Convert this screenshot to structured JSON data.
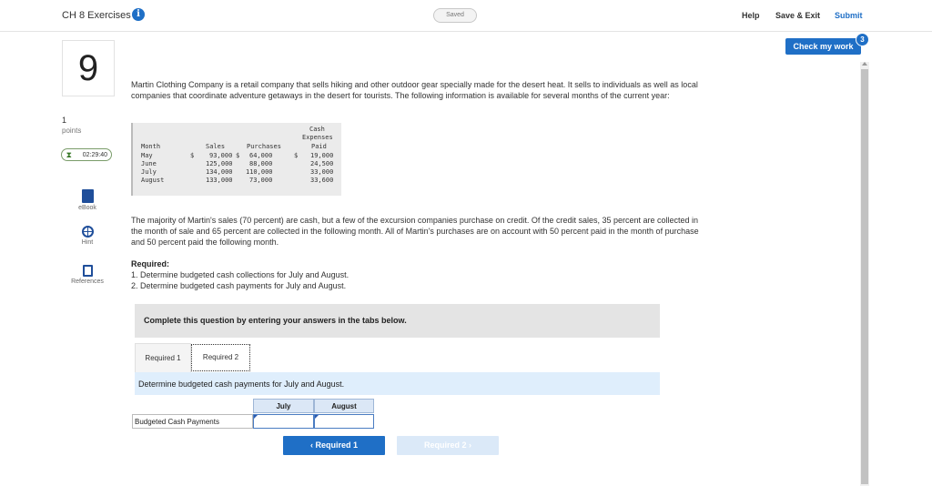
{
  "header": {
    "title": "CH 8 Exercises",
    "info_glyph": "i",
    "saved_label": "Saved",
    "help_label": "Help",
    "save_exit_label": "Save & Exit",
    "submit_label": "Submit",
    "check_label": "Check my work",
    "check_badge": "3",
    "accent_color": "#1f6fc6"
  },
  "sidebar": {
    "question_number": "9",
    "points_value": "1",
    "points_label": "points",
    "timer": "02:29:40",
    "tools": [
      {
        "label": "eBook",
        "icon": "ebook-icon"
      },
      {
        "label": "Hint",
        "icon": "hint-icon"
      },
      {
        "label": "References",
        "icon": "references-icon"
      }
    ]
  },
  "question": {
    "intro": "Martin Clothing Company is a retail company that sells hiking and other outdoor gear specially made for the desert heat. It sells to individuals as well as local companies that coordinate adventure getaways in the desert for tourists. The following information is available for several months of the current year:",
    "table": {
      "header_row1": "Cash",
      "header_row2": "Expenses",
      "col_month": "Month",
      "col_sales": "Sales",
      "col_purchases": "Purchases",
      "col_paid": "Paid",
      "rows": [
        {
          "month": "May",
          "sales_prefix": "$",
          "sales": "93,000",
          "purch_prefix": "$",
          "purchases": "64,000",
          "paid_prefix": "$",
          "paid": "19,000"
        },
        {
          "month": "June",
          "sales_prefix": "",
          "sales": "125,000",
          "purch_prefix": "",
          "purchases": "88,000",
          "paid_prefix": "",
          "paid": "24,500"
        },
        {
          "month": "July",
          "sales_prefix": "",
          "sales": "134,000",
          "purch_prefix": "",
          "purchases": "110,000",
          "paid_prefix": "",
          "paid": "33,000"
        },
        {
          "month": "August",
          "sales_prefix": "",
          "sales": "133,000",
          "purch_prefix": "",
          "purchases": "73,000",
          "paid_prefix": "",
          "paid": "33,600"
        }
      ]
    },
    "details": "The majority of Martin's sales (70 percent) are cash, but a few of the excursion companies purchase on credit. Of the credit sales, 35 percent are collected in the month of sale and 65 percent are collected in the following month. All of Martin's purchases are on account with 50 percent paid in the month of purchase and 50 percent paid the following month.",
    "required_title": "Required:",
    "required_items": [
      "1. Determine budgeted cash collections for July and August.",
      "2. Determine budgeted cash payments for July and August."
    ]
  },
  "answer_panel": {
    "instruction": "Complete this question by entering your answers in the tabs below.",
    "tabs": [
      "Required 1",
      "Required 2"
    ],
    "prompt": "Determine budgeted cash payments for July and August.",
    "col_july": "July",
    "col_august": "August",
    "row_label": "Budgeted Cash Payments",
    "july_value": "",
    "august_value": "",
    "prev_label": "‹  Required 1",
    "next_label": "Required 2  ›"
  }
}
